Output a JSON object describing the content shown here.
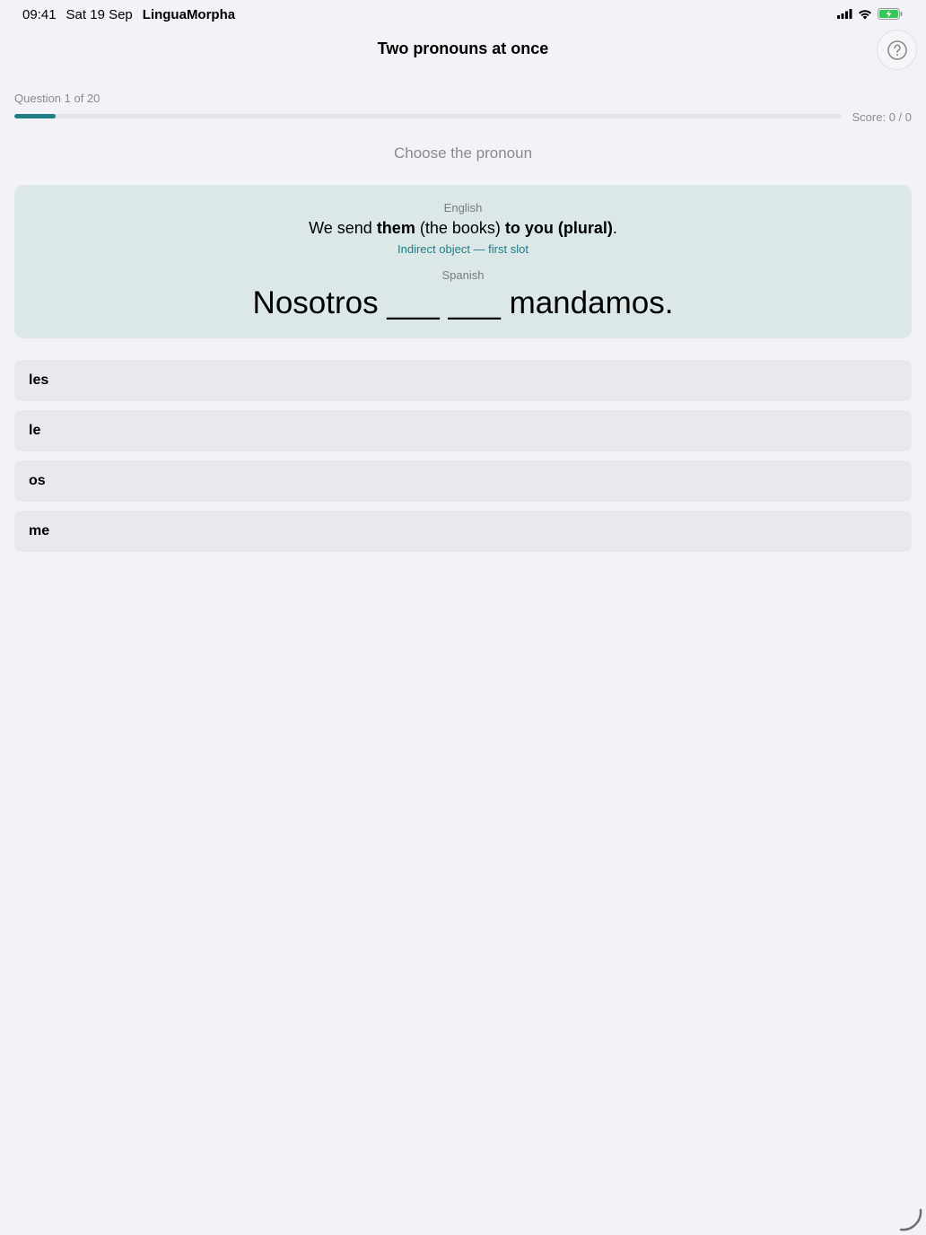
{
  "status": {
    "time": "09:41",
    "date": "Sat 19 Sep",
    "app": "LinguaMorpha",
    "battery_color": "#34c759"
  },
  "nav": {
    "title": "Two pronouns at once",
    "help_icon": "question-circle-icon"
  },
  "progress": {
    "label": "Question 1 of 20",
    "fraction": 0.05,
    "score": "Score: 0 / 0",
    "accent": "#1e7d85"
  },
  "prompt": "Choose the pronoun",
  "card": {
    "en_label": "English",
    "en_parts": [
      "We send ",
      "them",
      " (the books) ",
      "to you (plural)",
      "."
    ],
    "hint": "Indirect object — first slot",
    "es_label": "Spanish",
    "es_sentence": "Nosotros ___ ___ mandamos."
  },
  "options": [
    "les",
    "le",
    "os",
    "me"
  ]
}
